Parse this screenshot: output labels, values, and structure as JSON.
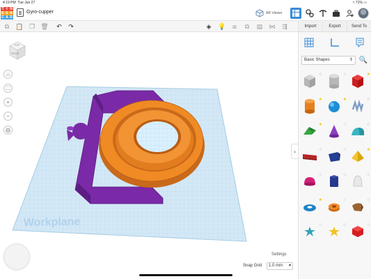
{
  "status_bar": {
    "time": "4:19 PM",
    "date": "Tue Jun 27",
    "battery": "71%"
  },
  "app": {
    "logo_letters": [
      "T",
      "I",
      "N",
      "K",
      "E",
      "R",
      "C",
      "A",
      "D"
    ],
    "design_title": "Gyro-cupper",
    "ar_viewer_label": "AR Viewer"
  },
  "right_actions": {
    "import_label": "Import",
    "export_label": "Export",
    "send_to_label": "Send To"
  },
  "canvas": {
    "view_cube_top": "TOP",
    "view_cube_front": "FRONT",
    "workplane_label": "Workplane",
    "settings_label": "Settings",
    "snap_grid_label": "Snap Grid",
    "snap_grid_value": "1.0 mm"
  },
  "panel": {
    "category": "Basic Shapes"
  },
  "shapes": [
    {
      "name": "box-striped",
      "starred": false
    },
    {
      "name": "cylinder-striped",
      "starred": false
    },
    {
      "name": "box",
      "starred": true
    },
    {
      "name": "cylinder",
      "starred": true
    },
    {
      "name": "sphere",
      "starred": true
    },
    {
      "name": "scribble",
      "starred": false
    },
    {
      "name": "roof",
      "starred": true
    },
    {
      "name": "cone",
      "starred": false
    },
    {
      "name": "round-roof",
      "starred": false
    },
    {
      "name": "text",
      "starred": false
    },
    {
      "name": "wedge",
      "starred": false
    },
    {
      "name": "pyramid",
      "starred": true
    },
    {
      "name": "half-sphere",
      "starred": false
    },
    {
      "name": "polygon",
      "starred": false
    },
    {
      "name": "paraboloid",
      "starred": false
    },
    {
      "name": "torus",
      "starred": true
    },
    {
      "name": "tube",
      "starred": false
    },
    {
      "name": "shape-generator",
      "starred": false
    },
    {
      "name": "star",
      "starred": false
    },
    {
      "name": "star-yellow",
      "starred": false
    },
    {
      "name": "icosahedron",
      "starred": false
    }
  ],
  "colors": {
    "accent": "#3a8bd8",
    "workplane": "#cfe6f5",
    "purple_part": "#7a2aa6",
    "orange_part": "#f08a24",
    "logo_red": "#e84b3c",
    "logo_orange": "#f5a623",
    "logo_blue": "#4aa3df"
  }
}
